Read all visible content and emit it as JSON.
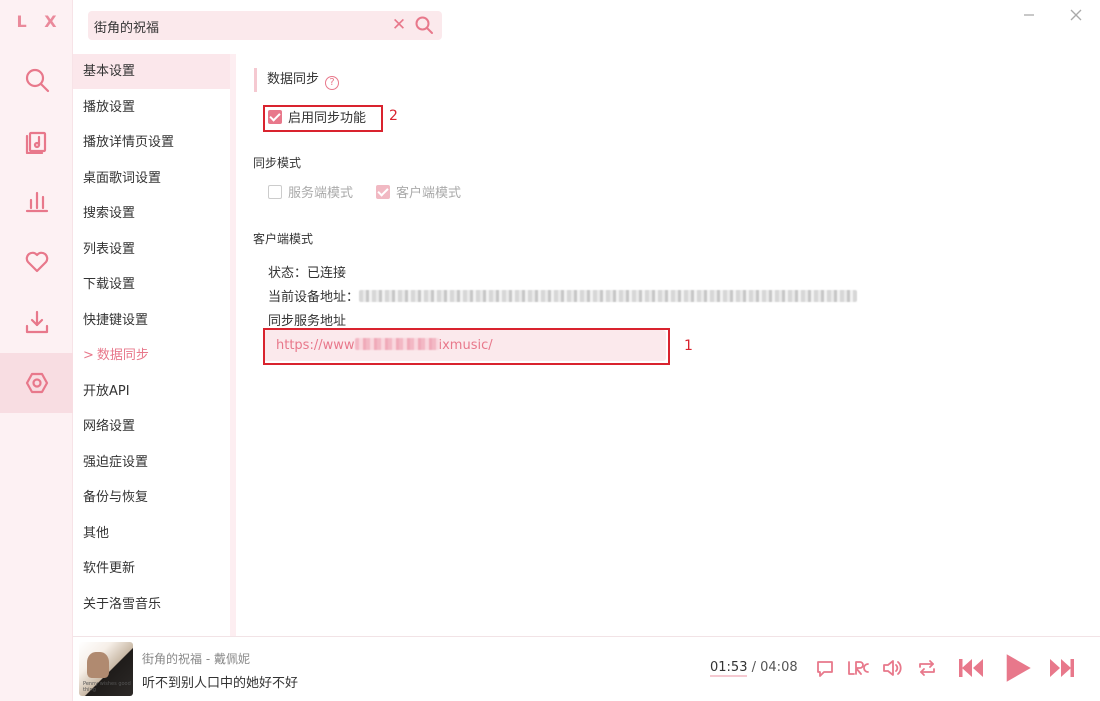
{
  "app": {
    "logo": "L X"
  },
  "search": {
    "value": "街角的祝福",
    "clear_glyph": "✕"
  },
  "sidebar": {
    "icons": [
      "search-icon",
      "song-list-icon",
      "leaderboard-icon",
      "favorite-icon",
      "download-icon",
      "settings-icon"
    ],
    "active": "settings-icon"
  },
  "settings_nav": {
    "items": [
      "基本设置",
      "播放设置",
      "播放详情页设置",
      "桌面歌词设置",
      "搜索设置",
      "列表设置",
      "下载设置",
      "快捷键设置",
      "数据同步",
      "开放API",
      "网络设置",
      "强迫症设置",
      "备份与恢复",
      "其他",
      "软件更新",
      "关于洛雪音乐"
    ],
    "current_marker": ">",
    "current_index": 8
  },
  "sync": {
    "title": "数据同步",
    "help_glyph": "?",
    "enable_label": "启用同步功能",
    "enable_checked": true,
    "mode_heading": "同步模式",
    "mode_server": "服务端模式",
    "mode_server_checked": false,
    "mode_client": "客户端模式",
    "mode_client_checked": true,
    "client_heading": "客户端模式",
    "status_label": "状态：",
    "status_value": "已连接",
    "device_addr_label": "当前设备地址：",
    "server_addr_label": "同步服务地址",
    "server_url_prefix": "https://www",
    "server_url_suffix": "ixmusic/"
  },
  "annotations": {
    "one": "1",
    "two": "2"
  },
  "player": {
    "song": "街角的祝福 - 戴佩妮",
    "lyric": "听不到别人口中的她好不好",
    "current_time": "01:53",
    "separator": "/",
    "total_time": "04:08",
    "cover_caption": "Penny wishes good thing"
  },
  "colors": {
    "accent": "#e8788b",
    "accent_light": "#fbe9ec",
    "annotation": "#d9232e"
  }
}
